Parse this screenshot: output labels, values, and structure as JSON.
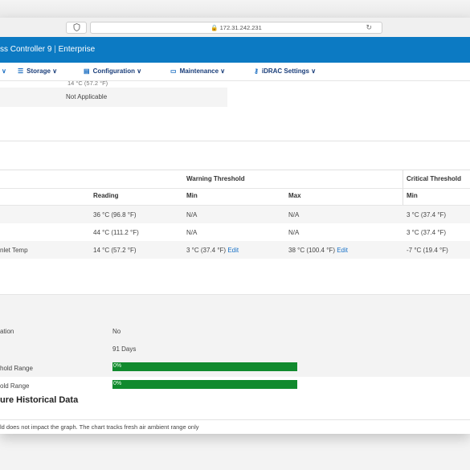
{
  "browser": {
    "url": "172.31.242.231",
    "lock_icon": "lock-icon",
    "shield_icon": "shield-icon",
    "reload_icon": "reload-icon"
  },
  "app": {
    "title_part1": "ss Controller 9",
    "title_part2": "Enterprise",
    "accent_color": "#0c7ac3"
  },
  "nav": {
    "items": [
      {
        "label": "Storage",
        "icon": "storage-icon"
      },
      {
        "label": "Configuration",
        "icon": "configuration-icon"
      },
      {
        "label": "Maintenance",
        "icon": "maintenance-icon"
      },
      {
        "label": "iDRAC Settings",
        "icon": "idrac-settings-icon"
      }
    ]
  },
  "top_section": {
    "overflow_value": "14 °C (57.2 °F)",
    "not_applicable": "Not Applicable"
  },
  "thresholds_table": {
    "group_headers": {
      "warning": "Warning Threshold",
      "critical": "Critical Threshold"
    },
    "sub_headers": {
      "reading": "Reading",
      "warning_min": "Min",
      "warning_max": "Max",
      "critical_min": "Min"
    },
    "rows": [
      {
        "name": "",
        "reading": "36 °C (96.8 °F)",
        "warning_min": "N/A",
        "warning_max": "N/A",
        "critical_min": "3 °C (37.4 °F)"
      },
      {
        "name": "",
        "reading": "44 °C (111.2 °F)",
        "warning_min": "N/A",
        "warning_max": "N/A",
        "critical_min": "3 °C (37.4 °F)"
      },
      {
        "name": "nlet Temp",
        "reading": "14 °C (57.2 °F)",
        "warning_min": "3 °C (37.4 °F)",
        "warning_max": "38 °C (100.4 °F)",
        "critical_min": "-7 °C (19.4 °F)",
        "edit_label": "Edit"
      }
    ]
  },
  "airflow": {
    "rows": [
      {
        "label": "ation",
        "value": "No"
      },
      {
        "label": "",
        "value": "91 Days"
      },
      {
        "label": "hold Range",
        "progress_text": "0%",
        "progress": 0
      },
      {
        "label": "old Range",
        "progress_text": "0%",
        "progress": 0
      }
    ],
    "bar_color": "#118a2e"
  },
  "historical": {
    "title": "ure Historical Data",
    "note": "ld does not impact the graph. The chart tracks fresh air ambient range only"
  }
}
